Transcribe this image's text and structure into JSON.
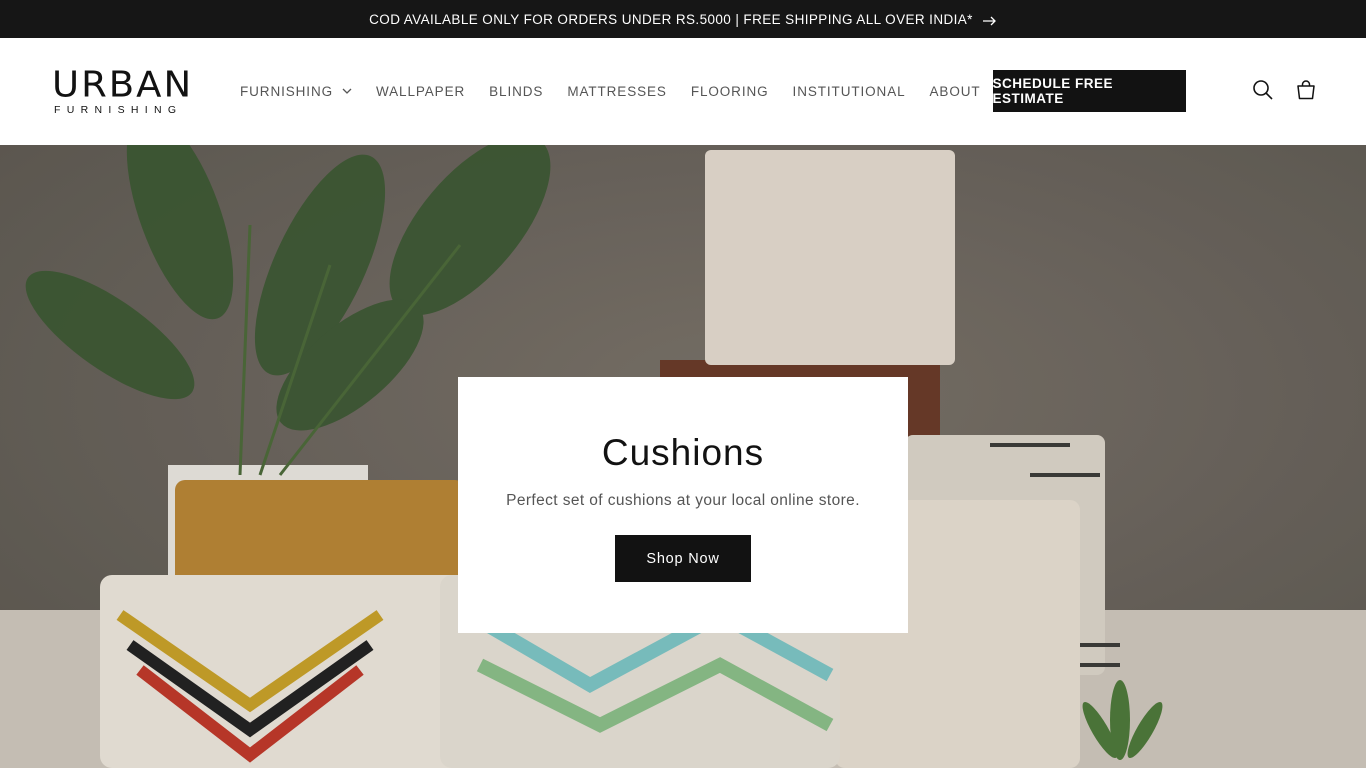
{
  "announcement": {
    "text": "COD AVAILABLE ONLY FOR ORDERS UNDER RS.5000 | FREE SHIPPING ALL OVER INDIA*",
    "icon": "arrow-right-icon"
  },
  "header": {
    "logo": {
      "word": "URBAN",
      "sub": "FURNISHING"
    },
    "nav": [
      {
        "label": "FURNISHING",
        "has_dropdown": true
      },
      {
        "label": "WALLPAPER"
      },
      {
        "label": "BLINDS"
      },
      {
        "label": "MATTRESSES"
      },
      {
        "label": "FLOORING"
      },
      {
        "label": "INSTITUTIONAL"
      },
      {
        "label": "ABOUT"
      }
    ],
    "cta_label": "SCHEDULE FREE ESTIMATE",
    "icons": [
      "search-icon",
      "cart-icon"
    ]
  },
  "hero": {
    "title": "Cushions",
    "subtitle": "Perfect set of cushions at your local online store.",
    "button_label": "Shop Now"
  },
  "colors": {
    "bar": "#161616",
    "button": "#121212",
    "wall": "#6d675f"
  }
}
